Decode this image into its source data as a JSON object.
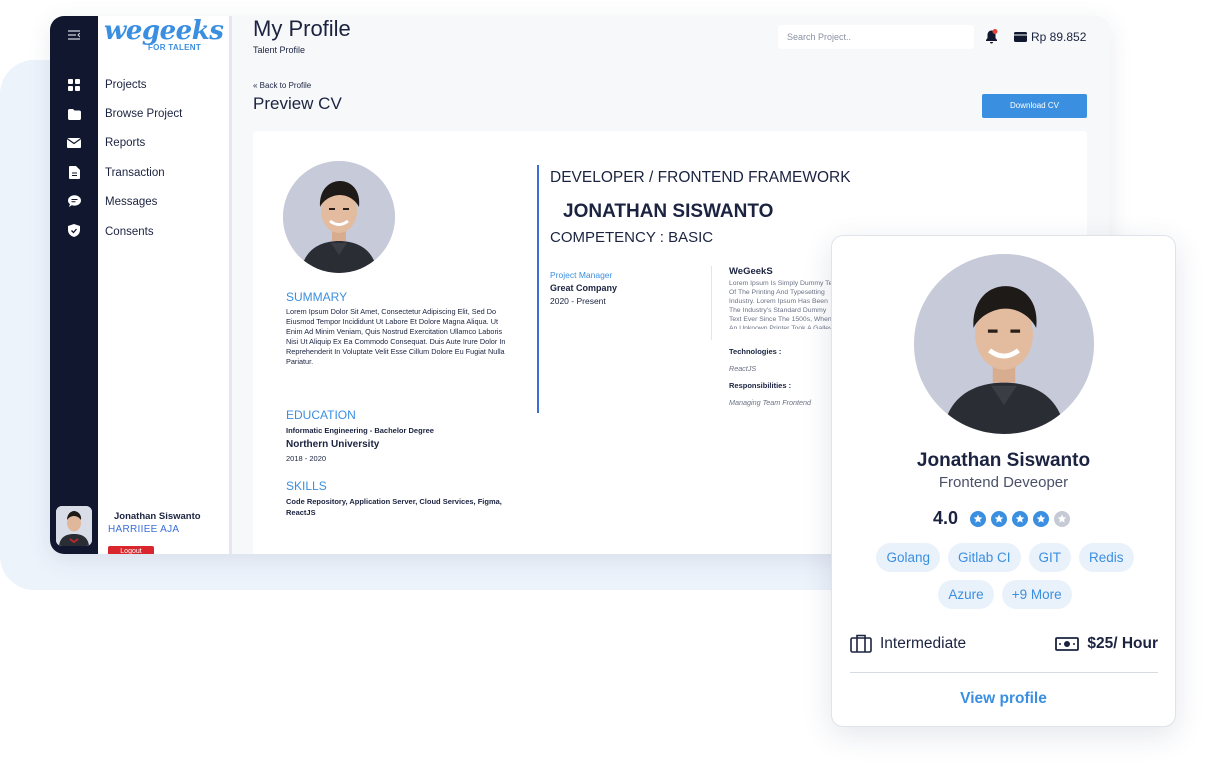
{
  "brand": {
    "logo_text": "wegeeks",
    "logo_sub": "FOR TALENT"
  },
  "nav": {
    "items": [
      {
        "label": "Projects",
        "icon": "grid-icon"
      },
      {
        "label": "Browse Project",
        "icon": "folder-icon"
      },
      {
        "label": "Reports",
        "icon": "mail-icon"
      },
      {
        "label": "Transaction",
        "icon": "document-icon"
      },
      {
        "label": "Messages",
        "icon": "chat-icon"
      },
      {
        "label": "Consents",
        "icon": "shield-icon"
      }
    ],
    "user_name": "Jonathan Siswanto",
    "user_second": "HARRIIEE AJA",
    "logout_label": "Logout"
  },
  "header": {
    "title": "My Profile",
    "subtitle": "Talent Profile",
    "search_placeholder": "Search Project..",
    "balance": "Rp 89.852"
  },
  "page": {
    "back_label": "« Back to Profile",
    "heading": "Preview CV",
    "download_label": "Download CV"
  },
  "cv": {
    "summary_heading": "SUMMARY",
    "summary_text": "Lorem Ipsum Dolor Sit Amet, Consectetur Adipiscing Elit, Sed Do Eiusmod Tempor Incididunt Ut Labore Et Dolore Magna Aliqua. Ut Enim Ad Minim Veniam, Quis Nostrud Exercitation Ullamco Laboris Nisi Ut Aliquip Ex Ea Commodo Consequat. Duis Aute Irure Dolor In Reprehenderit In Voluptate Velit Esse Cillum Dolore Eu Fugiat Nulla Pariatur.",
    "education_heading": "EDUCATION",
    "education_degree": "Informatic Engineering - Bachelor Degree",
    "education_school": "Northern University",
    "education_years": "2018 - 2020",
    "skills_heading": "SKILLS",
    "skills_text": "Code Repository, Application Server, Cloud Services, Figma, ReactJS",
    "role": "DEVELOPER / FRONTEND FRAMEWORK",
    "name": "JONATHAN SISWANTO",
    "competency": "COMPETENCY : BASIC",
    "exp_position": "Project Manager",
    "exp_company": "Great Company",
    "exp_period": "2020 - Present",
    "project_name": "WeGeekS",
    "project_desc": "Lorem Ipsum Is Simply Dummy Text Of The Printing And Typesetting Industry. Lorem Ipsum Has Been The Industry's Standard Dummy Text Ever Since The 1500s, When An Unknown Printer Took A Galley Of Type And Scrambled It To Make A Type Specimen Book. It Has Survived Not Only Five Centuries, But Also The Leap Into Electronic Typesetting, Remaining Essentially Unchanged.",
    "tech_label": "Technologies :",
    "tech_value": "ReactJS",
    "resp_label": "Responsibilities :",
    "resp_value": "Managing Team Frontend"
  },
  "card": {
    "name": "Jonathan Siswanto",
    "role": "Frontend Deveoper",
    "rating": 4.0,
    "rating_text": "4.0",
    "stars_total": 5,
    "tags": [
      "Golang",
      "Gitlab CI",
      "GIT",
      "Redis",
      "Azure",
      "+9 More"
    ],
    "level": "Intermediate",
    "rate": "$25/ Hour",
    "view_label": "View profile"
  },
  "colors": {
    "accent": "#3b8fe0",
    "navy": "#10172e",
    "danger": "#d9262c",
    "star_empty": "#c5cad6"
  }
}
